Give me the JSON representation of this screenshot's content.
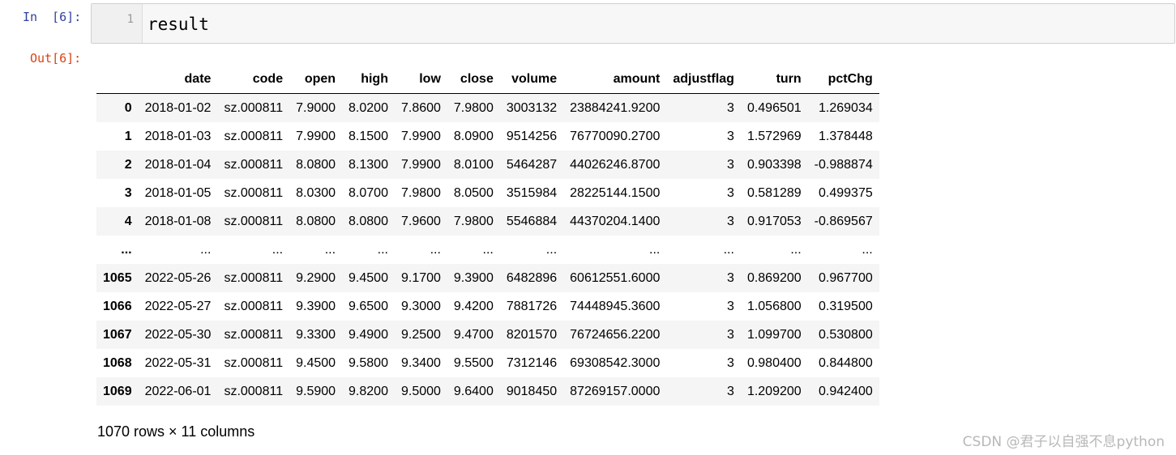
{
  "cell": {
    "in_prompt": "In  [6]:",
    "line_number": "1",
    "code": "result",
    "out_prompt": "Out[6]:"
  },
  "table": {
    "columns": [
      "",
      "date",
      "code",
      "open",
      "high",
      "low",
      "close",
      "volume",
      "amount",
      "adjustflag",
      "turn",
      "pctChg"
    ],
    "rows": [
      [
        "0",
        "2018-01-02",
        "sz.000811",
        "7.9000",
        "8.0200",
        "7.8600",
        "7.9800",
        "3003132",
        "23884241.9200",
        "3",
        "0.496501",
        "1.269034"
      ],
      [
        "1",
        "2018-01-03",
        "sz.000811",
        "7.9900",
        "8.1500",
        "7.9900",
        "8.0900",
        "9514256",
        "76770090.2700",
        "3",
        "1.572969",
        "1.378448"
      ],
      [
        "2",
        "2018-01-04",
        "sz.000811",
        "8.0800",
        "8.1300",
        "7.9900",
        "8.0100",
        "5464287",
        "44026246.8700",
        "3",
        "0.903398",
        "-0.988874"
      ],
      [
        "3",
        "2018-01-05",
        "sz.000811",
        "8.0300",
        "8.0700",
        "7.9800",
        "8.0500",
        "3515984",
        "28225144.1500",
        "3",
        "0.581289",
        "0.499375"
      ],
      [
        "4",
        "2018-01-08",
        "sz.000811",
        "8.0800",
        "8.0800",
        "7.9600",
        "7.9800",
        "5546884",
        "44370204.1400",
        "3",
        "0.917053",
        "-0.869567"
      ],
      [
        "...",
        "...",
        "...",
        "...",
        "...",
        "...",
        "...",
        "...",
        "...",
        "...",
        "...",
        "..."
      ],
      [
        "1065",
        "2022-05-26",
        "sz.000811",
        "9.2900",
        "9.4500",
        "9.1700",
        "9.3900",
        "6482896",
        "60612551.6000",
        "3",
        "0.869200",
        "0.967700"
      ],
      [
        "1066",
        "2022-05-27",
        "sz.000811",
        "9.3900",
        "9.6500",
        "9.3000",
        "9.4200",
        "7881726",
        "74448945.3600",
        "3",
        "1.056800",
        "0.319500"
      ],
      [
        "1067",
        "2022-05-30",
        "sz.000811",
        "9.3300",
        "9.4900",
        "9.2500",
        "9.4700",
        "8201570",
        "76724656.2200",
        "3",
        "1.099700",
        "0.530800"
      ],
      [
        "1068",
        "2022-05-31",
        "sz.000811",
        "9.4500",
        "9.5800",
        "9.3400",
        "9.5500",
        "7312146",
        "69308542.3000",
        "3",
        "0.980400",
        "0.844800"
      ],
      [
        "1069",
        "2022-06-01",
        "sz.000811",
        "9.5900",
        "9.8200",
        "9.5000",
        "9.6400",
        "9018450",
        "87269157.0000",
        "3",
        "1.209200",
        "0.942400"
      ]
    ]
  },
  "shape_text": "1070 rows × 11 columns",
  "watermark": "CSDN @君子以自强不息python",
  "colors": {
    "in_prompt": "#303f9f",
    "out_prompt": "#d84315",
    "stripe": "#f5f5f5"
  }
}
